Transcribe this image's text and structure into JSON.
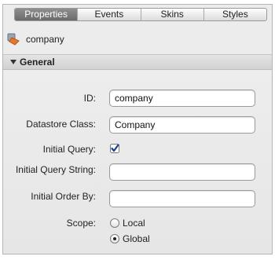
{
  "tabs": [
    {
      "label": "Properties",
      "active": true
    },
    {
      "label": "Events",
      "active": false
    },
    {
      "label": "Skins",
      "active": false
    },
    {
      "label": "Styles",
      "active": false
    }
  ],
  "entity": {
    "name": "company",
    "icon": "datastore-class-icon"
  },
  "section": {
    "title": "General",
    "expanded": true
  },
  "fields": {
    "id": {
      "label": "ID:",
      "value": "company"
    },
    "datastore_class": {
      "label": "Datastore Class:",
      "value": "Company"
    },
    "initial_query": {
      "label": "Initial Query:",
      "checked": true
    },
    "initial_query_string": {
      "label": "Initial Query String:",
      "value": ""
    },
    "initial_order_by": {
      "label": "Initial Order By:",
      "value": ""
    },
    "scope": {
      "label": "Scope:",
      "options": [
        {
          "label": "Local",
          "selected": false
        },
        {
          "label": "Global",
          "selected": true
        }
      ]
    }
  },
  "colors": {
    "active_tab": "#7a7a7a",
    "checkmark": "#1d3f8f",
    "icon_orange": "#e8772e"
  }
}
